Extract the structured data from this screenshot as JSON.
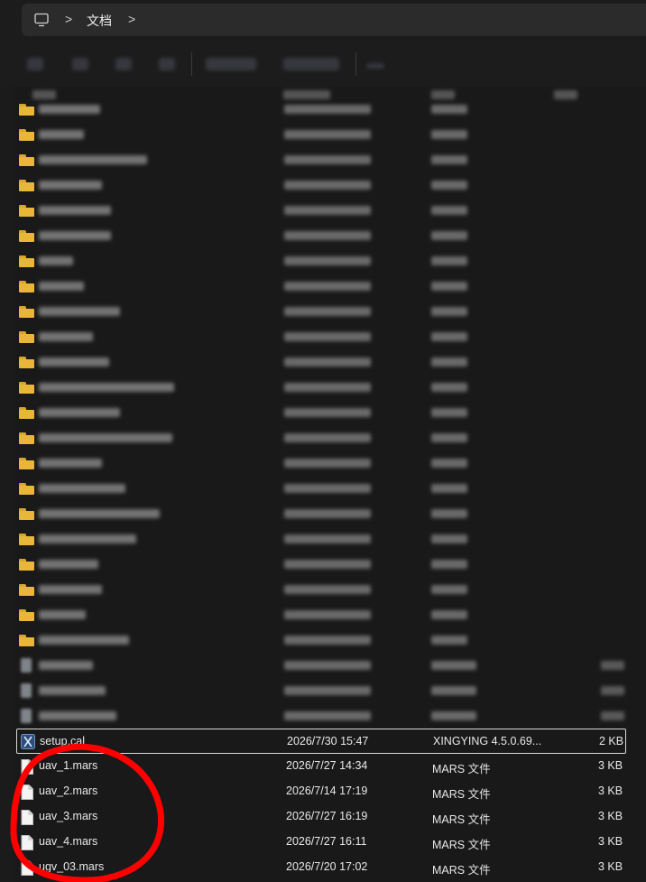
{
  "breadcrumb": {
    "separator": ">",
    "current": "文档"
  },
  "icons": {
    "monitor": "monitor-icon",
    "folder": "folder-icon",
    "file": "file-icon",
    "cal": "xingying-app-icon"
  },
  "files": [
    {
      "name": "setup.cal",
      "date": "2026/7/30 15:47",
      "type": "XINGYING 4.5.0.69...",
      "size": "2 KB",
      "selected": true
    },
    {
      "name": "uav_1.mars",
      "date": "2026/7/27 14:34",
      "type": "MARS 文件",
      "size": "3 KB"
    },
    {
      "name": "uav_2.mars",
      "date": "2026/7/14 17:19",
      "type": "MARS 文件",
      "size": "3 KB"
    },
    {
      "name": "uav_3.mars",
      "date": "2026/7/27 16:19",
      "type": "MARS 文件",
      "size": "3 KB"
    },
    {
      "name": "uav_4.mars",
      "date": "2026/7/27 16:11",
      "type": "MARS 文件",
      "size": "3 KB"
    },
    {
      "name": "ugv_03.mars",
      "date": "2026/7/20 17:02",
      "type": "MARS 文件",
      "size": "3 KB"
    }
  ],
  "annotation": {
    "color": "#ff0000"
  }
}
